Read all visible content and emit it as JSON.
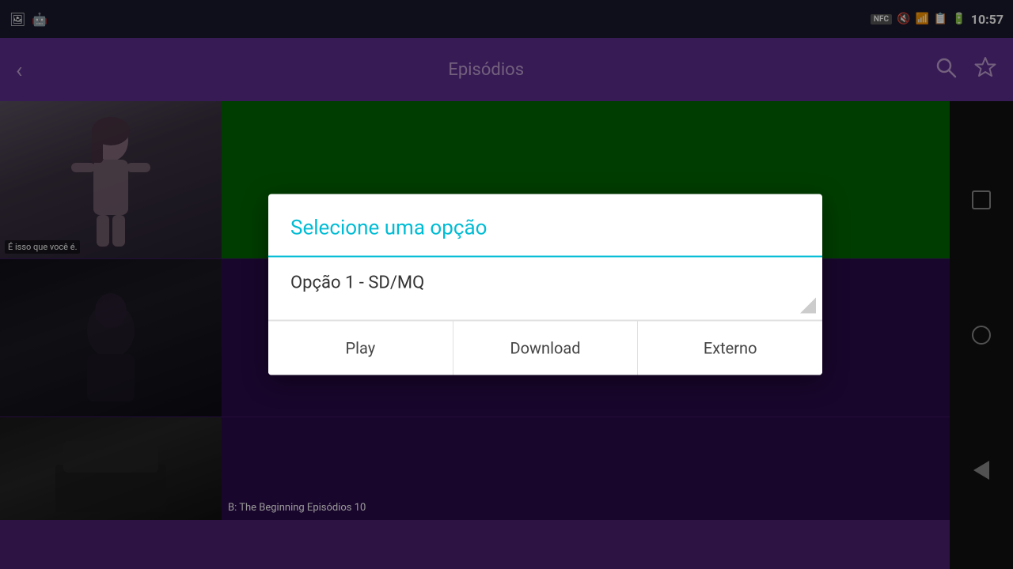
{
  "statusBar": {
    "leftIcons": [
      "image-icon",
      "android-icon"
    ],
    "nfc": "NFC",
    "time": "10:57"
  },
  "toolbar": {
    "backLabel": "‹",
    "title": "Episódios",
    "searchLabel": "🔍",
    "starLabel": "☆"
  },
  "episodes": [
    {
      "thumbText": "É isso que você é.",
      "infoText": ""
    },
    {
      "thumbText": "",
      "infoText": ""
    },
    {
      "thumbText": "B: The Beginning Episódios 10",
      "infoText": ""
    }
  ],
  "dialog": {
    "title": "Selecione uma opção",
    "optionLabel": "Opção 1 - SD/MQ",
    "actions": {
      "play": "Play",
      "download": "Download",
      "external": "Externo"
    }
  }
}
